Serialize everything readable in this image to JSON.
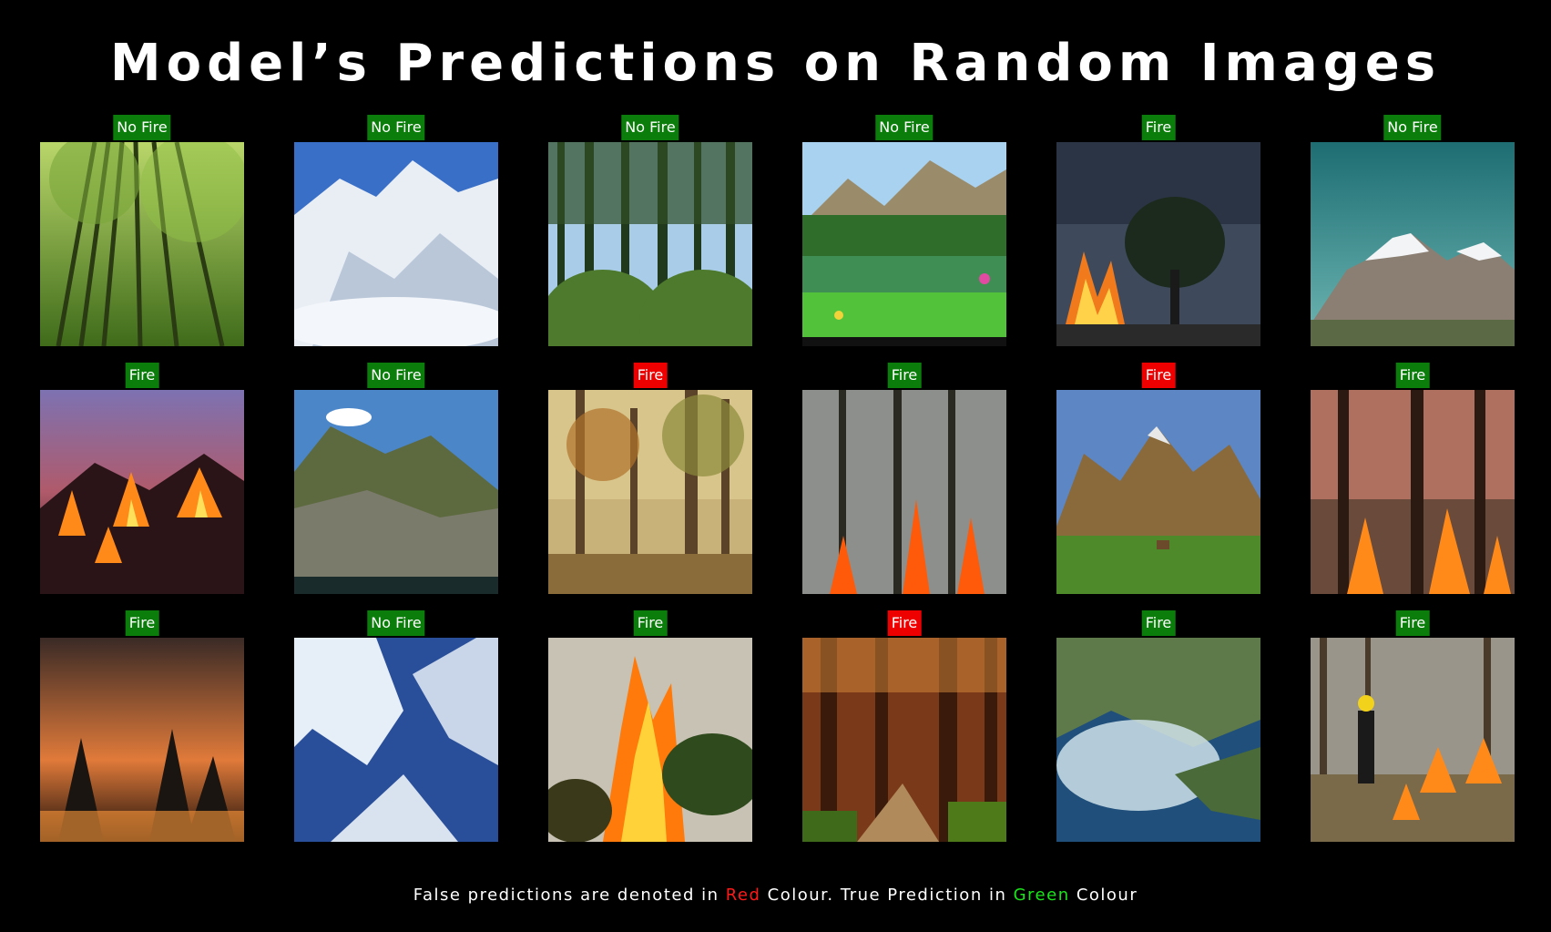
{
  "title": "Model’s Predictions on Random Images",
  "colors": {
    "true_prediction": "#0a7d0a",
    "false_prediction": "#ee0000"
  },
  "predictions": [
    {
      "label": "No Fire",
      "correct": true,
      "scene": "green-forest"
    },
    {
      "label": "No Fire",
      "correct": true,
      "scene": "snowy-mountain"
    },
    {
      "label": "No Fire",
      "correct": true,
      "scene": "panorama-forest"
    },
    {
      "label": "No Fire",
      "correct": true,
      "scene": "alpine-lake"
    },
    {
      "label": "Fire",
      "correct": true,
      "scene": "burning-tree"
    },
    {
      "label": "No Fire",
      "correct": true,
      "scene": "snow-peaks"
    },
    {
      "label": "Fire",
      "correct": true,
      "scene": "night-wildfire"
    },
    {
      "label": "No Fire",
      "correct": true,
      "scene": "green-mountain"
    },
    {
      "label": "Fire",
      "correct": false,
      "scene": "autumn-forest"
    },
    {
      "label": "Fire",
      "correct": true,
      "scene": "smoky-forest-fire"
    },
    {
      "label": "Fire",
      "correct": false,
      "scene": "mountain-village"
    },
    {
      "label": "Fire",
      "correct": true,
      "scene": "forest-floor-fire"
    },
    {
      "label": "Fire",
      "correct": true,
      "scene": "orange-smoke-fire"
    },
    {
      "label": "No Fire",
      "correct": true,
      "scene": "glacier-mountain"
    },
    {
      "label": "Fire",
      "correct": true,
      "scene": "flame-column"
    },
    {
      "label": "Fire",
      "correct": false,
      "scene": "redwood-path"
    },
    {
      "label": "Fire",
      "correct": true,
      "scene": "aerial-smoke"
    },
    {
      "label": "Fire",
      "correct": true,
      "scene": "firefighter"
    }
  ],
  "footer": {
    "part1": "False predictions are denoted in ",
    "red_word": "Red",
    "part2": " Colour. True Prediction in ",
    "green_word": "Green",
    "part3": " Colour"
  }
}
